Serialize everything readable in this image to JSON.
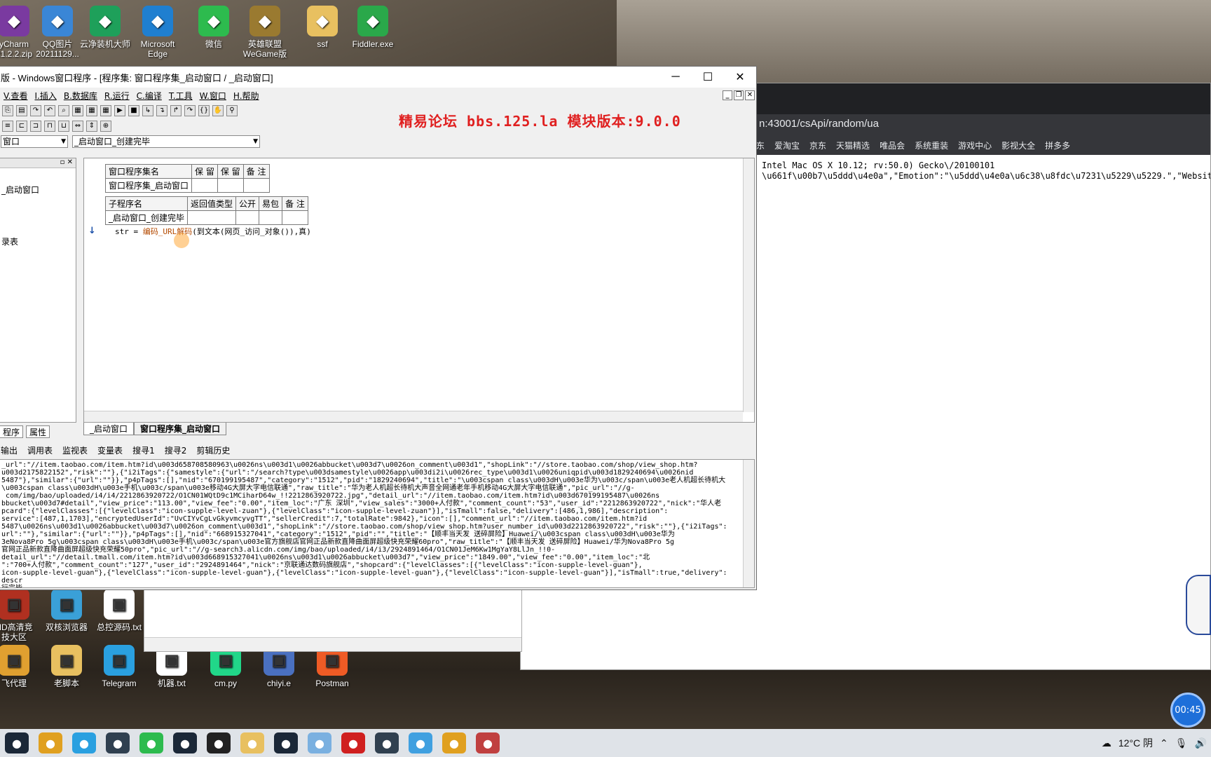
{
  "desktop": {
    "top_icons": [
      {
        "label": "yCharm\n21.2.2.zip",
        "icon": "winrar-icon",
        "color": "#7a3aa0"
      },
      {
        "label": "QQ图片\n20211129...",
        "icon": "image-icon",
        "color": "#3a86d6"
      },
      {
        "label": "云净装机大师",
        "icon": "shield-icon",
        "color": "#1ea05a"
      },
      {
        "label": "Microsoft\nEdge",
        "icon": "edge-icon",
        "color": "#1f7fd0"
      },
      {
        "label": "微信",
        "icon": "wechat-icon",
        "color": "#2dbb4e"
      },
      {
        "label": "英雄联盟\nWeGame版",
        "icon": "lol-icon",
        "color": "#9a7a30"
      },
      {
        "label": "ssf",
        "icon": "folder-icon",
        "color": "#e8c060"
      },
      {
        "label": "Fiddler.exe",
        "icon": "fiddler-icon",
        "color": "#2aa84a"
      }
    ],
    "bottom_icons": [
      {
        "label": "HD高清竞\n技大区",
        "icon": "game-icon",
        "color": "#b03020"
      },
      {
        "label": "双核浏览器",
        "icon": "browser-icon",
        "color": "#3aa0d8"
      },
      {
        "label": "总控源码.txt",
        "icon": "text-file-icon",
        "color": "#ffffff"
      },
      {
        "label": "飞代理",
        "icon": "proxy-icon",
        "color": "#e0a030"
      },
      {
        "label": "老脚本",
        "icon": "folder-icon",
        "color": "#e8c060"
      },
      {
        "label": "Telegram",
        "icon": "telegram-icon",
        "color": "#2aa0e0"
      },
      {
        "label": "机器.txt",
        "icon": "text-file-icon",
        "color": "#ffffff"
      },
      {
        "label": "cm.py",
        "icon": "pycharm-icon",
        "color": "#21d789"
      },
      {
        "label": "chiyi.e",
        "icon": "e-file-icon",
        "color": "#4a70c0"
      },
      {
        "label": "Postman",
        "icon": "postman-icon",
        "color": "#ef5b25"
      }
    ]
  },
  "browser": {
    "address": "n:43001/csApi/random/ua",
    "bookmarks": [
      "东",
      "爱淘宝",
      "京东",
      "天猫精选",
      "唯品会",
      "系统重装",
      "游戏中心",
      "影视大全",
      "拼多多"
    ],
    "content_lines": [
      "Intel Mac OS X 10.12; rv:50.0) Gecko\\/20100101",
      "\\u661f\\u00b7\\u5ddd\\u4e0a\",\"Emotion\":\"\\u5ddd\\u4e0a\\u6c38\\u8fdc\\u7231\\u5229\\u5229.\",\"Website\":\""
    ]
  },
  "ide": {
    "title": "版 - Windows窗口程序 - [程序集: 窗口程序集_启动窗口 / _启动窗口]",
    "menu": [
      "V.查看",
      "I.插入",
      "B.数据库",
      "R.运行",
      "C.编译",
      "T.工具",
      "W.窗口",
      "H.帮助"
    ],
    "banner": "精易论坛 bbs.125.la 模块版本:9.0.0",
    "combo_left": "窗口",
    "combo_right": "_启动窗口_创建完毕",
    "tree_items": [
      "_启动窗口",
      "录表"
    ],
    "panel_tabs": [
      "程序",
      "属性"
    ],
    "assembly_table": {
      "headers": [
        "窗口程序集名",
        "保 留",
        "保 留",
        "备 注"
      ],
      "row": [
        "窗口程序集_启动窗口",
        "",
        "",
        ""
      ]
    },
    "sub_table": {
      "headers": [
        "子程序名",
        "返回值类型",
        "公开",
        "易包",
        "备 注"
      ],
      "row": [
        "_启动窗口_创建完毕",
        "",
        "",
        "",
        ""
      ]
    },
    "code": {
      "prefix": "str = ",
      "call": "编码_URL解码",
      "rest": "(到文本(网页_访问_对象()),真)"
    },
    "doc_tabs": [
      "_启动窗口",
      "窗口程序集_启动窗口"
    ],
    "output_tabs": [
      "输出",
      "调用表",
      "监视表",
      "变量表",
      "搜寻1",
      "搜寻2",
      "剪辑历史"
    ],
    "output_lines": [
      "_url\":\"//item.taobao.com/item.htm?id\\u003d658708580963\\u0026ns\\u003d1\\u0026abbucket\\u003d7\\u0026on_comment\\u003d1\",\"shopLink\":\"//store.taobao.com/shop/view_shop.htm?",
      "u003d2175822152\",\"risk\":\"\"},{\"i2iTags\":{\"samestyle\":{\"url\":\"/search?type\\u003dsamestyle\\u0026app\\u003di2i\\u0026rec_type\\u003d1\\u0026uniqpid\\u003d1829240694\\u0026nid",
      "5487\"},\"similar\":{\"url\":\"\"}},\"p4pTags\":[],\"nid\":\"670199195487\",\"category\":\"1512\",\"pid\":\"1829240694\",\"title\":\"\\u003cspan class\\u003dH\\u003e华为\\u003c/span\\u003e老人机超长待机大",
      "\\u003cspan class\\u003dH\\u003e手机\\u003c/span\\u003e移动4G大屏大字电信联通\",\"raw_title\":\"华为老人机超长待机大声音全网通老年手机移动4G大屏大字电信联通\",\"pic_url\":\"//g-",
      " com/img/bao/uploaded/i4/i4/2212863920722/O1CN01WQtD9c1MCiharD64w_!!2212863920722.jpg\",\"detail_url\":\"//item.taobao.com/item.htm?id\\u003d670199195487\\u0026ns",
      "bbucket\\u003d7#detail\",\"view_price\":\"113.00\",\"view_fee\":\"0.00\",\"item_loc\":\"广东 深圳\",\"view_sales\":\"3000+人付款\",\"comment_count\":\"53\",\"user_id\":\"2212863920722\",\"nick\":\"华人老",
      "pcard\":{\"levelClasses\":[{\"levelClass\":\"icon-supple-level-zuan\"},{\"levelClass\":\"icon-supple-level-zuan\"}],\"isTmall\":false,\"delivery\":[486,1,986],\"description\":",
      "service\":[487,1,1703],\"encryptedUserId\":\"UvCIYvCgLvGkyvmcyvgTT\",\"sellerCredit\":7,\"totalRate\":9842},\"icon\":[],\"comment_url\":\"//item.taobao.com/item.htm?id",
      "5487\\u0026ns\\u003d1\\u0026abbucket\\u003d7\\u0026on_comment\\u003d1\",\"shopLink\":\"//store.taobao.com/shop/view_shop.htm?user_number_id\\u003d2212863920722\",\"risk\":\"\"},{\"i2iTags\":",
      "url\":\"\"},\"similar\":{\"url\":\"\"}},\"p4pTags\":[],\"nid\":\"668915327041\",\"category\":\"1512\",\"pid\":\"\",\"title\":\"【顺丰当天发 送碎屏险】Huawei/\\u003cspan class\\u003dH\\u003e华为",
      "3eNova8Pro 5g\\u003cspan class\\u003dH\\u003e手机\\u003c/span\\u003e官方旗舰店官网正品新款直降曲面屏超级快充荣耀60pro\",\"raw_title\":\"【顺丰当天发 送碎屏险】Huawei/华为Nova8Pro 5g",
      "官网正品新款直降曲面屏超级快充荣耀50pro\",\"pic_url\":\"//g-search3.alicdn.com/img/bao/uploaded/i4/i3/2924891464/O1CN01JeM6Kw1MgYaY8LlJn_!!0-",
      "detail_url\":\"//detail.tmall.com/item.htm?id\\u003d668915327041\\u0026ns\\u003d1\\u0026abbucket\\u003d7\",\"view_price\":\"1849.00\",\"view_fee\":\"0.00\",\"item_loc\":\"北",
      "\":\"700+人付款\",\"comment_count\":\"127\",\"user_id\":\"2924891464\",\"nick\":\"京联通达数码旗舰店\",\"shopcard\":{\"levelClasses\":[{\"levelClass\":\"icon-supple-level-guan\"},",
      "icon-supple-level-guan\"},{\"levelClass\":\"icon-supple-level-guan\"},{\"levelClass\":\"icon-supple-level-guan\"},{\"levelClass\":\"icon-supple-level-guan\"}],\"isTmall\":true,\"delivery\":",
      "descr",
      "行完毕"
    ]
  },
  "taskbar": {
    "weather": "12°C 阴",
    "clock_bubble": "00:45",
    "apps": [
      {
        "icon": "steam-icon",
        "color": "#1b2838"
      },
      {
        "icon": "chrome-icon",
        "color": "#e0a020"
      },
      {
        "icon": "telegram-icon",
        "color": "#2aa0e0"
      },
      {
        "icon": "window-icon",
        "color": "#304050"
      },
      {
        "icon": "wechat-icon",
        "color": "#2dbb4e"
      },
      {
        "icon": "steam-icon",
        "color": "#1b2838"
      },
      {
        "icon": "qq-icon",
        "color": "#222222"
      },
      {
        "icon": "folder-icon",
        "color": "#e8c060"
      },
      {
        "icon": "steam-icon",
        "color": "#1b2838"
      },
      {
        "icon": "notepad-icon",
        "color": "#7ab0e0"
      },
      {
        "icon": "netease-icon",
        "color": "#d02020"
      },
      {
        "icon": "window-icon",
        "color": "#304050"
      },
      {
        "icon": "app-icon",
        "color": "#40a0e0"
      },
      {
        "icon": "chrome-icon",
        "color": "#e0a020"
      },
      {
        "icon": "e-lang-icon",
        "color": "#c04040"
      }
    ]
  }
}
